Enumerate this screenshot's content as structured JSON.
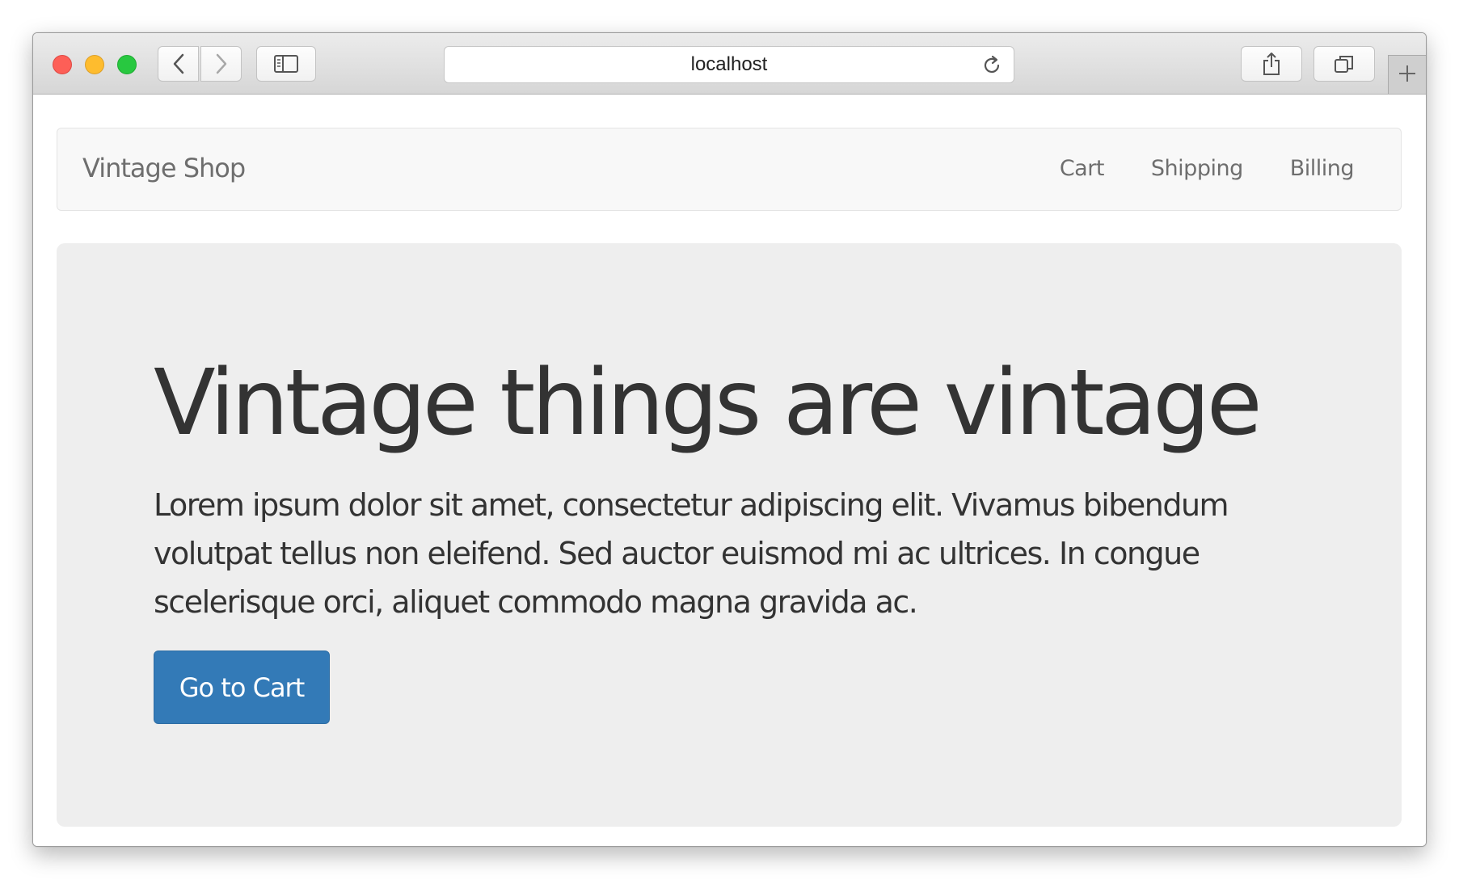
{
  "browser": {
    "address": "localhost",
    "icons": {
      "back": "chevron-left-icon",
      "forward": "chevron-right-icon",
      "sidebar": "sidebar-icon",
      "reload": "reload-icon",
      "share": "share-icon",
      "tabs": "tabs-overview-icon",
      "new_tab": "plus-icon"
    },
    "colors": {
      "close": "#fd5f57",
      "minimize": "#febc2e",
      "maximize": "#28c840"
    }
  },
  "navbar": {
    "brand": "Vintage Shop",
    "links": [
      "Cart",
      "Shipping",
      "Billing"
    ]
  },
  "hero": {
    "title": "Vintage things are vintage",
    "lead": "Lorem ipsum dolor sit amet, consectetur adipiscing elit. Vivamus bibendum volutpat tellus non eleifend. Sed auctor euismod mi ac ultrices. In congue scelerisque orci, aliquet commodo magna gravida ac.",
    "button_label": "Go to Cart",
    "button_color": "#337ab7"
  }
}
